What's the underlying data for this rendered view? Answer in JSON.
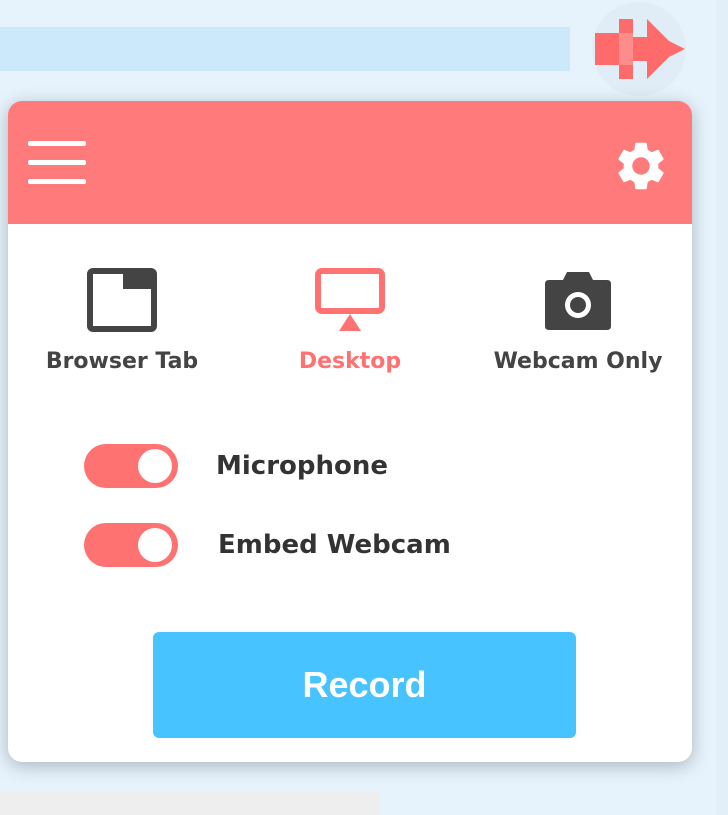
{
  "colors": {
    "accent": "#ff7b7b",
    "accent_text": "#ff7272",
    "record_button": "#47c4ff",
    "text_dark": "#444444",
    "toggle_on": "#ff7272"
  },
  "header": {
    "menu_icon": "hamburger-menu-icon",
    "settings_icon": "gear-icon"
  },
  "modes": [
    {
      "label": "Browser Tab",
      "icon": "browser-tab-icon",
      "selected": false
    },
    {
      "label": "Desktop",
      "icon": "monitor-icon",
      "selected": true
    },
    {
      "label": "Webcam Only",
      "icon": "camera-icon",
      "selected": false
    }
  ],
  "options": [
    {
      "label": "Microphone",
      "enabled": true
    },
    {
      "label": "Embed Webcam",
      "enabled": true
    }
  ],
  "record": {
    "label": "Record"
  }
}
